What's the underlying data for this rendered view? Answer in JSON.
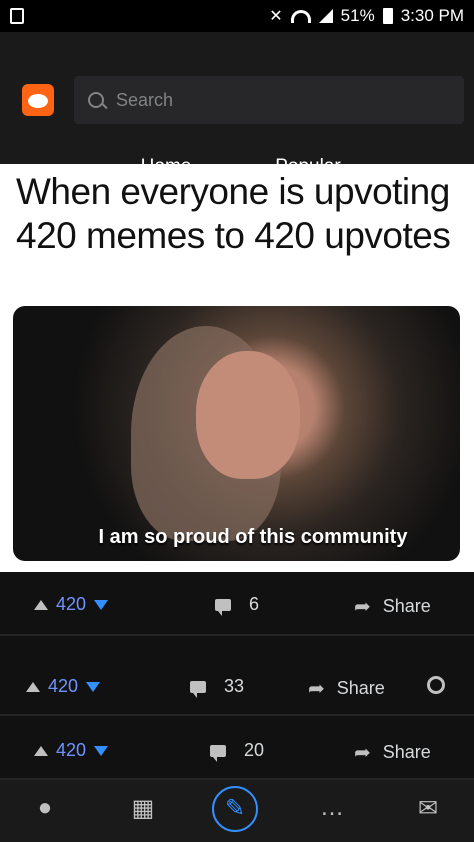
{
  "status": {
    "battery_percent": "51%",
    "time": "3:30 PM"
  },
  "search": {
    "placeholder": "Search"
  },
  "tabs": [
    {
      "label": "Home"
    },
    {
      "label": "Popular"
    }
  ],
  "meme": {
    "caption": "When everyone is upvoting 420 memes to 420 upvotes",
    "subtitle": "I am so proud of this community"
  },
  "posts": [
    {
      "votes": "420",
      "comments": "6",
      "share": "Share"
    },
    {
      "votes": "420",
      "comments": "33",
      "share": "Share"
    },
    {
      "votes": "420",
      "comments": "20",
      "share": "Share"
    }
  ]
}
